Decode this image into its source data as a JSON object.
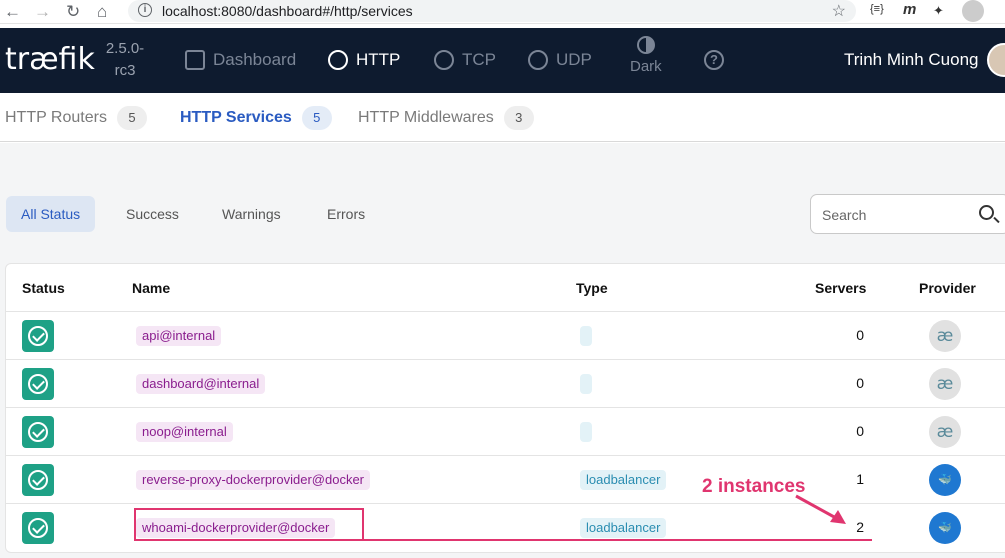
{
  "browser": {
    "url": "localhost:8080/dashboard#/http/services",
    "back_icon": "←",
    "forward_icon": "→",
    "reload_icon": "↻",
    "home_icon": "⌂",
    "info_icon": "i",
    "star_icon": "☆",
    "ext1": "{≡}",
    "ext2": "m",
    "ext3": "✦"
  },
  "topbar": {
    "logo": "træfik",
    "version": "2.5.0-rc3",
    "nav": [
      {
        "label": "Dashboard",
        "active": false
      },
      {
        "label": "HTTP",
        "active": true
      },
      {
        "label": "TCP",
        "active": false
      },
      {
        "label": "UDP",
        "active": false
      }
    ],
    "dark_label": "Dark",
    "help_icon": "?",
    "username": "Trinh Minh Cuong"
  },
  "subtabs": [
    {
      "label": "HTTP Routers",
      "count": "5",
      "active": false
    },
    {
      "label": "HTTP Services",
      "count": "5",
      "active": true
    },
    {
      "label": "HTTP Middlewares",
      "count": "3",
      "active": false
    }
  ],
  "filters": [
    {
      "label": "All Status",
      "active": true
    },
    {
      "label": "Success",
      "active": false
    },
    {
      "label": "Warnings",
      "active": false
    },
    {
      "label": "Errors",
      "active": false
    }
  ],
  "search": {
    "placeholder": "Search"
  },
  "table": {
    "headers": {
      "status": "Status",
      "name": "Name",
      "type": "Type",
      "servers": "Servers",
      "provider": "Provider"
    },
    "rows": [
      {
        "name": "api@internal",
        "type": "",
        "servers": "0",
        "provider": "internal",
        "provider_glyph": "æ"
      },
      {
        "name": "dashboard@internal",
        "type": "",
        "servers": "0",
        "provider": "internal",
        "provider_glyph": "æ"
      },
      {
        "name": "noop@internal",
        "type": "",
        "servers": "0",
        "provider": "internal",
        "provider_glyph": "æ"
      },
      {
        "name": "reverse-proxy-dockerprovider@docker",
        "type": "loadbalancer",
        "servers": "1",
        "provider": "docker",
        "provider_glyph": "🐳"
      },
      {
        "name": "whoami-dockerprovider@docker",
        "type": "loadbalancer",
        "servers": "2",
        "provider": "docker",
        "provider_glyph": "🐳"
      }
    ]
  },
  "annotation": {
    "text": "2 instances",
    "color": "#e0356f"
  }
}
